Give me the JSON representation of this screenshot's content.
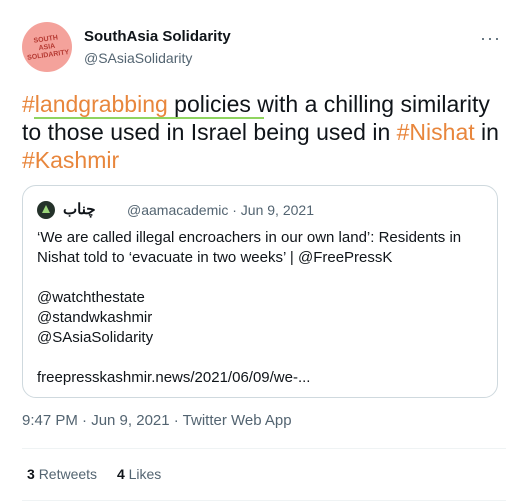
{
  "author": {
    "name": "SouthAsia Solidarity",
    "handle": "@SAsiaSolidarity",
    "avatar_text": "SOUTH ASIA SOLIDARITY",
    "more_label": "···"
  },
  "tweet": {
    "hashtag1": "#landgrabbing",
    "text1": " policies with a chilling similarity to those used in Israel being used in ",
    "hashtag2": "#Nishat",
    "text2": " in ",
    "hashtag3": "#Kashmir"
  },
  "quote": {
    "name": "چناب",
    "meta": "@aamacademic · Jun 9, 2021",
    "line1": "‘We are called illegal encroachers in our own land’: Residents in",
    "line2": "Nishat told to ‘evacuate in two weeks’ | @FreePressK",
    "mention1": "@watchthestate",
    "mention2": "@standwkashmir",
    "mention3": "@SAsiaSolidarity",
    "link": "freepresskashmir.news/2021/06/09/we-..."
  },
  "timestamp": "9:47 PM · Jun 9, 2021 · Twitter Web App",
  "stats": {
    "retweets_count": "3",
    "retweets_label": "Retweets",
    "likes_count": "4",
    "likes_label": "Likes"
  },
  "colors": {
    "hashtag": "#e8863c",
    "highlight": "#8fd45f",
    "secondary_text": "#536471"
  }
}
